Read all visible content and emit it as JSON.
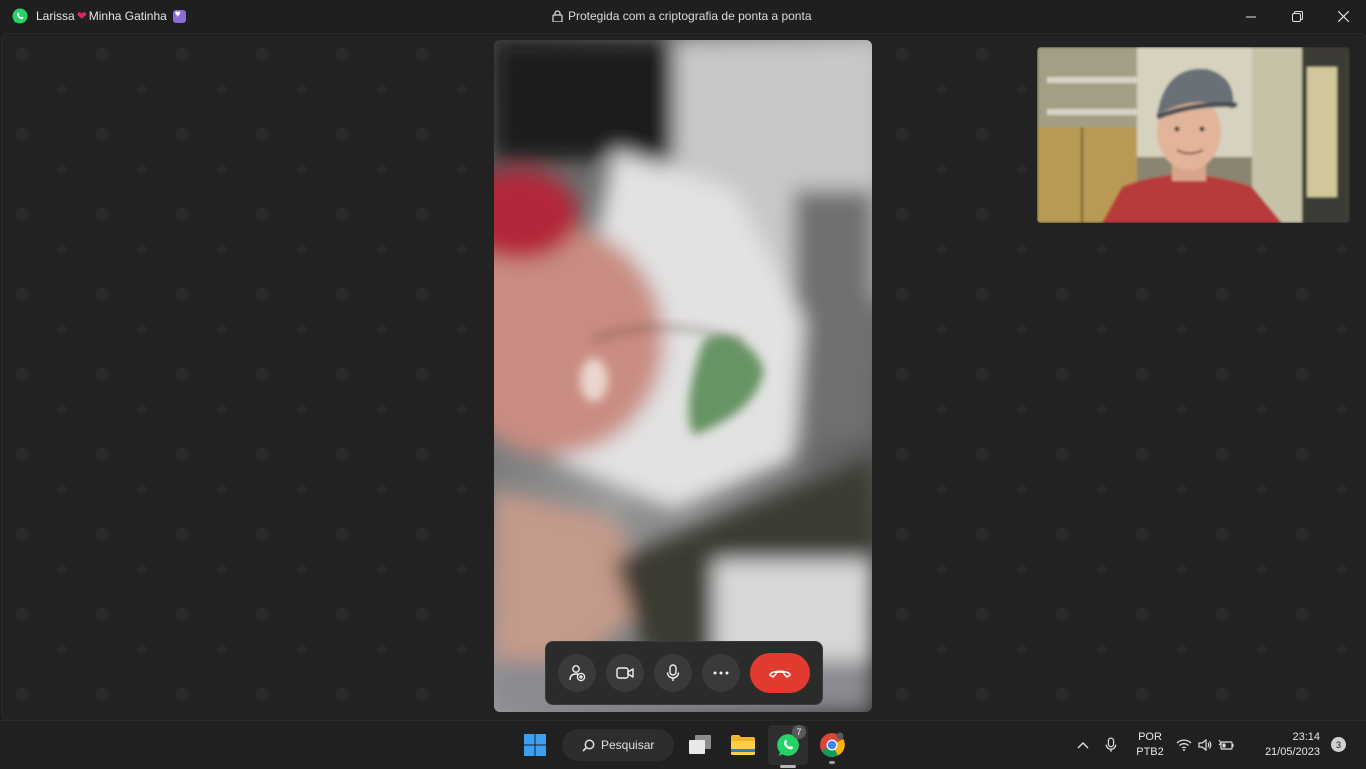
{
  "window": {
    "contact_name_first": "Larissa",
    "contact_name_rest": "Minha Gatinha",
    "encryption_text": "Protegida com a criptografia de ponta a ponta"
  },
  "call": {
    "controls": [
      {
        "name": "add-participant",
        "icon": "person-add-icon"
      },
      {
        "name": "camera",
        "icon": "video-camera-icon"
      },
      {
        "name": "microphone",
        "icon": "microphone-icon"
      },
      {
        "name": "more",
        "icon": "ellipsis-icon"
      },
      {
        "name": "end-call",
        "icon": "phone-hangup-icon"
      }
    ],
    "end_call_color": "#e03b2e"
  },
  "taskbar": {
    "search_label": "Pesquisar",
    "whatsapp_badge": "7",
    "language": "POR",
    "layout": "PTB2",
    "time": "23:14",
    "date": "21/05/2023",
    "notifications": "3"
  },
  "colors": {
    "whatsapp_green": "#25d366",
    "windows_blue": "#3aa0f3"
  }
}
